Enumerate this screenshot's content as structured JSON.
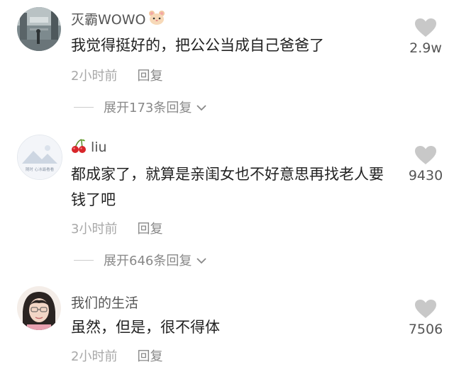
{
  "comments": [
    {
      "username": "灭霸WOWO",
      "username_badge": "hamster-emoji",
      "content": "我觉得挺好的，把公公当成自己爸爸了",
      "time": "2小时前",
      "reply_label": "回复",
      "expand_label": "展开173条回复",
      "likes": "2.9w"
    },
    {
      "username": "liu",
      "username_prefix": "cherry-emoji",
      "avatar_text": "随时 心冰最看看",
      "content": "都成家了，就算是亲闺女也不好意思再找老人要钱了吧",
      "time": "3小时前",
      "reply_label": "回复",
      "expand_label": "展开646条回复",
      "likes": "9430"
    },
    {
      "username": "我们的生活",
      "content": "虽然，但是，很不得体",
      "time": "2小时前",
      "reply_label": "回复",
      "likes": "7506"
    }
  ],
  "colors": {
    "text": "#222222",
    "username": "#555555",
    "meta": "#a8a8a8",
    "heart": "#c8c8c8"
  }
}
